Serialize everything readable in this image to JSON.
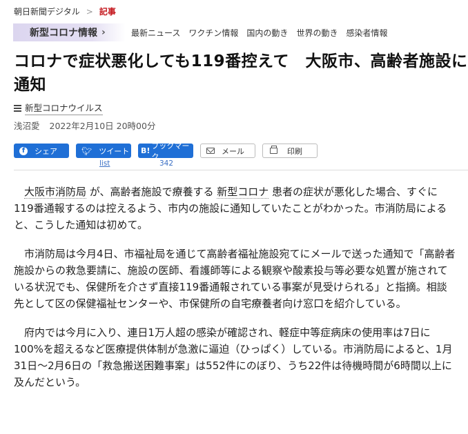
{
  "breadcrumb": {
    "home": "朝日新聞デジタル",
    "separator": ">",
    "current": "記事"
  },
  "nav": {
    "featured": "新型コロナ情報",
    "featured_chevron": "›",
    "items": [
      "最新ニュース",
      "ワクチン情報",
      "国内の動き",
      "世界の動き",
      "感染者情報"
    ]
  },
  "article": {
    "title": "コロナで症状悪化しても119番控えて　大阪市、高齢者施設に通知",
    "topic": "新型コロナウイルス",
    "author": "浅沼愛",
    "date": "2022年2月10日 20時00分",
    "paragraphs": {
      "p1_kw1": "大阪市消防局",
      "p1_a": " が、高齢者施設で療養する ",
      "p1_kw2": "新型コロナ",
      "p1_b": " 患者の症状が悪化した場合、すぐに119番通報するのは控えるよう、市内の施設に通知していたことがわかった。市消防局によると、こうした通知は初めて。",
      "p2": "市消防局は今月4日、市福祉局を通じて高齢者福祉施設宛てにメールで送った通知で「高齢者施設からの救急要請に、施設の医師、看護師等による観察や酸素投与等必要な処置が施されている状況でも、保健所を介さず直接119番通報されている事案が見受けられる」と指摘。相談先として区の保健福祉センターや、市保健所の自宅療養者向け窓口を紹介している。",
      "p3": "府内では今月に入り、連日1万人超の感染が確認され、軽症中等症病床の使用率は7日に100%を超えるなど医療提供体制が急激に逼迫（ひっぱく）している。市消防局によると、1月31日～2月6日の「救急搬送困難事案」は552件にのぼり、うち22件は待機時間が6時間以上に及んだという。"
    }
  },
  "share": {
    "facebook": {
      "label": "シェア",
      "icon": "facebook-icon"
    },
    "twitter": {
      "label": "ツイート",
      "icon": "twitter-icon",
      "count": "list"
    },
    "hatena": {
      "label": "ブックマーク",
      "icon": "hatena-bookmark-icon",
      "icon_text": "B!",
      "count": "342"
    },
    "mail": {
      "label": "メール",
      "icon": "mail-icon"
    },
    "print": {
      "label": "印刷",
      "icon": "print-icon"
    }
  },
  "colors": {
    "accent_red": "#c4161c",
    "share_blue": "#1f6fd6",
    "link_blue": "#3a6fc4"
  }
}
